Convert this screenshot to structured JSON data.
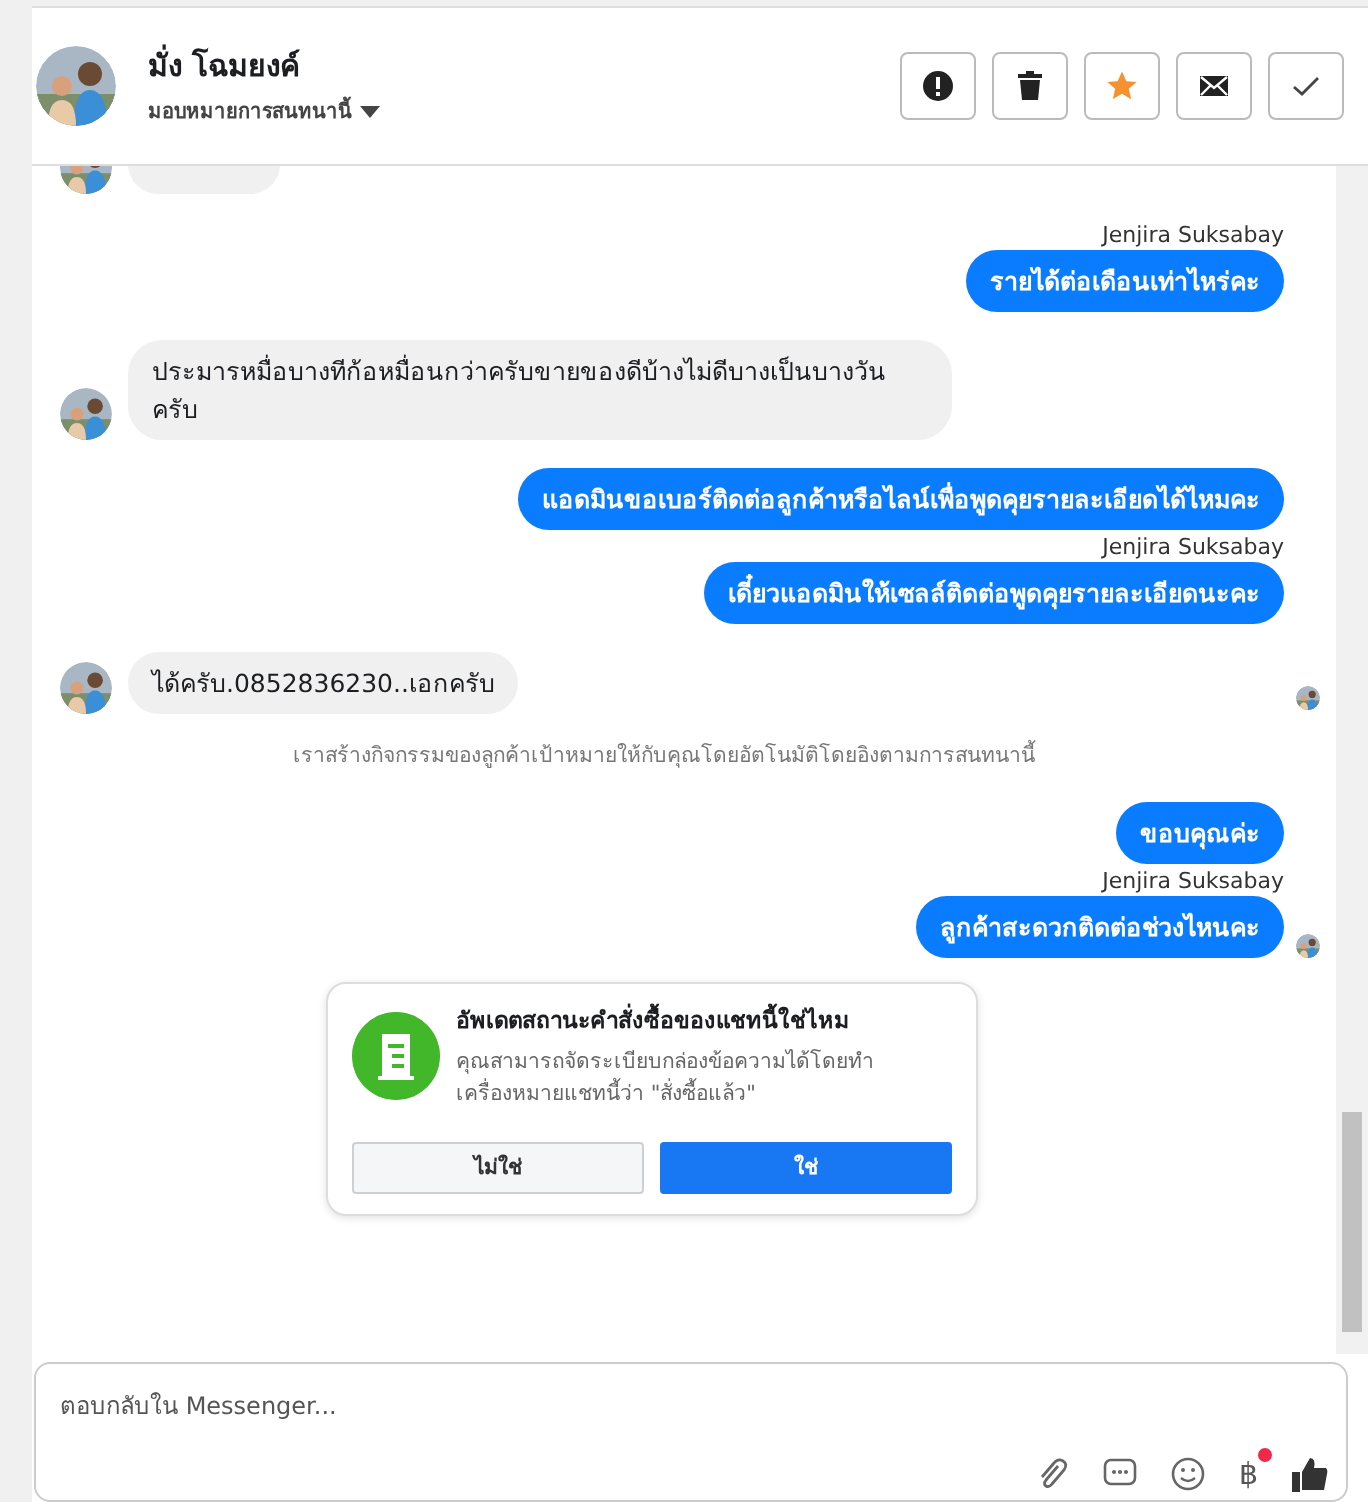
{
  "header": {
    "name": "มั่ง โฉมยงค์",
    "subtitle": "มอบหมายการสนทนานี้",
    "starred": true
  },
  "actions": [
    {
      "kind": "report"
    },
    {
      "kind": "delete"
    },
    {
      "kind": "star"
    },
    {
      "kind": "mail"
    },
    {
      "kind": "done"
    }
  ],
  "messages": [
    {
      "kind": "partial",
      "read": false
    },
    {
      "kind": "sender",
      "text": "Jenjira Suksabay"
    },
    {
      "kind": "outgoing",
      "text": "รายได้ต่อเดือนเท่าไหร่คะ",
      "read": false
    },
    {
      "kind": "incoming",
      "text": "ประมารหมื่อบางทีก้อหมื่อนกว่าครับขายของดีบ้างไม่ดีบางเป็นบางวันครับ",
      "read": false
    },
    {
      "kind": "outgoing",
      "text": "แอดมินขอเบอร์ติดต่อลูกค้าหรือไลน์เพื่อพูดคุยรายละเอียดได้ไหมคะ",
      "read": false
    },
    {
      "kind": "sender",
      "text": "Jenjira Suksabay"
    },
    {
      "kind": "outgoing",
      "text": "เดี๋ยวแอดมินให้เซลล์ติดต่อพูดคุยรายละเอียดนะคะ",
      "read": false
    },
    {
      "kind": "incoming",
      "text": "ได้ครับ.0852836230..เอกครับ",
      "read": true
    },
    {
      "kind": "notice",
      "text": "เราสร้างกิจกรรมของลูกค้าเป้าหมายให้กับคุณโดยอัตโนมัติโดยอิงตามการสนทนานี้"
    },
    {
      "kind": "outgoing",
      "text": "ขอบคุณค่ะ",
      "read": false
    },
    {
      "kind": "sender",
      "text": "Jenjira Suksabay"
    },
    {
      "kind": "outgoing",
      "text": "ลูกค้าสะดวกติดต่อช่วงไหนคะ",
      "read": true
    }
  ],
  "prompt_card": {
    "title": "อัพเดตสถานะคำสั่งซื้อของแชทนี้ใช่ไหม",
    "body": "คุณสามารถจัดระเบียบกล่องข้อความได้โดยทำเครื่องหมายแชทนี้ว่า \"สั่งซื้อแล้ว\"",
    "buttons": [
      {
        "label": "ไม่ใช่",
        "kind": "secondary"
      },
      {
        "label": "ใช่",
        "kind": "primary"
      }
    ]
  },
  "composer": {
    "placeholder": "ตอบกลับใน Messenger...",
    "currency_symbol": "฿",
    "currency_badge": true
  }
}
